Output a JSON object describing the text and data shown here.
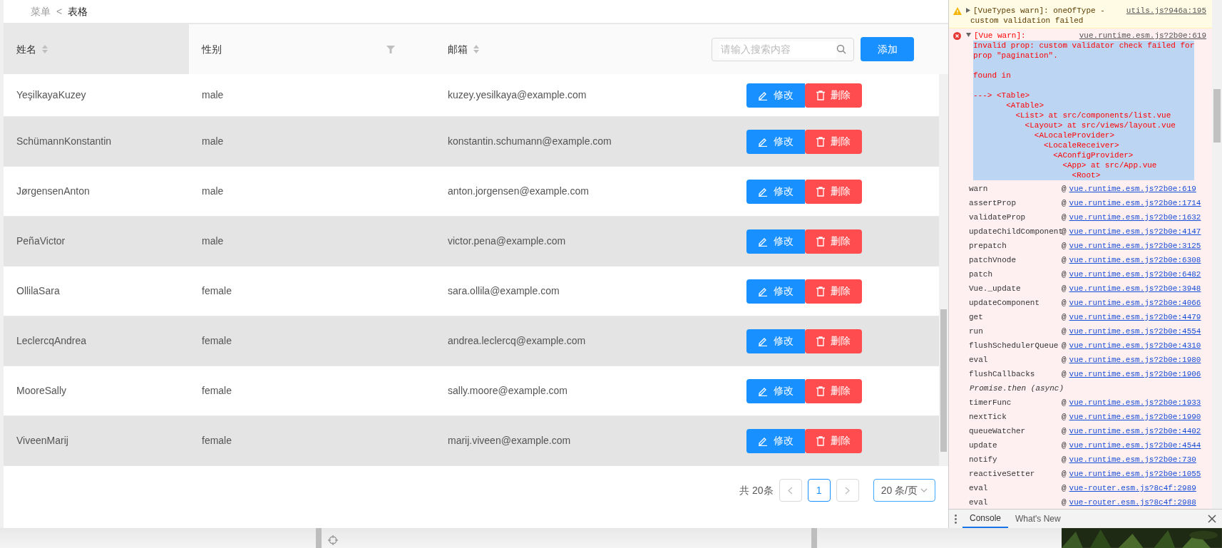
{
  "breadcrumb": {
    "items": [
      "菜单",
      "表格"
    ],
    "separator": "<"
  },
  "table": {
    "columns": [
      {
        "label": "姓名",
        "sortable": true,
        "filterable": false,
        "highlighted": true
      },
      {
        "label": "性别",
        "sortable": false,
        "filterable": true,
        "highlighted": false
      },
      {
        "label": "邮箱",
        "sortable": true,
        "filterable": false,
        "highlighted": false
      }
    ],
    "search": {
      "placeholder": "请输入搜索内容"
    },
    "add_button": "添加",
    "rows": [
      {
        "name": "YeşilkayaKuzey",
        "gender": "male",
        "email": "kuzey.yesilkaya@example.com",
        "actions": [
          "修改",
          "删除"
        ]
      },
      {
        "name": "SchümannKonstantin",
        "gender": "male",
        "email": "konstantin.schumann@example.com",
        "actions": [
          "修改",
          "删除"
        ]
      },
      {
        "name": "JørgensenAnton",
        "gender": "male",
        "email": "anton.jorgensen@example.com",
        "actions": [
          "修改",
          "删除"
        ]
      },
      {
        "name": "PeñaVictor",
        "gender": "male",
        "email": "victor.pena@example.com",
        "actions": [
          "修改",
          "删除"
        ]
      },
      {
        "name": "OllilaSara",
        "gender": "female",
        "email": "sara.ollila@example.com",
        "actions": [
          "修改",
          "删除"
        ]
      },
      {
        "name": "LeclercqAndrea",
        "gender": "female",
        "email": "andrea.leclercq@example.com",
        "actions": [
          "修改",
          "删除"
        ]
      },
      {
        "name": "MooreSally",
        "gender": "female",
        "email": "sally.moore@example.com",
        "actions": [
          "修改",
          "删除"
        ]
      },
      {
        "name": "ViveenMarij",
        "gender": "female",
        "email": "marij.viveen@example.com",
        "actions": [
          "修改",
          "删除"
        ]
      }
    ]
  },
  "pagination": {
    "total": "共 20条",
    "pages": [
      {
        "label": "1",
        "selected": true
      }
    ],
    "page_size": "20 条/页"
  },
  "console": {
    "messages": [
      {
        "kind": "warning",
        "expanded": false,
        "lines": [
          "[VueTypes warn]: oneOfType -",
          "custom validation failed"
        ],
        "source": "utils.js?946a:195"
      },
      {
        "kind": "error",
        "expanded": true,
        "lines": [
          "[Vue warn]:"
        ],
        "source": "vue.runtime.esm.js?2b0e:619",
        "body": "Invalid prop: custom validator check failed for\nprop \"pagination\".\n\nfound in\n\n---> <Table>\n       <ATable>\n         <List> at src/components/list.vue\n           <Layout> at src/views/layout.vue\n             <ALocaleProvider>\n               <LocaleReceiver>\n                 <AConfigProvider>\n                   <App> at src/App.vue\n                     <Root>",
        "body_selected": true,
        "stack": [
          {
            "kind": "frame",
            "function": "warn",
            "at": "@",
            "source": "vue.runtime.esm.js?2b0e:619"
          },
          {
            "kind": "frame",
            "function": "assertProp",
            "at": "@",
            "source": "vue.runtime.esm.js?2b0e:1714"
          },
          {
            "kind": "frame",
            "function": "validateProp",
            "at": "@",
            "source": "vue.runtime.esm.js?2b0e:1632"
          },
          {
            "kind": "frame",
            "function": "updateChildComponent",
            "at": "@",
            "source": "vue.runtime.esm.js?2b0e:4147"
          },
          {
            "kind": "frame",
            "function": "prepatch",
            "at": "@",
            "source": "vue.runtime.esm.js?2b0e:3125"
          },
          {
            "kind": "frame",
            "function": "patchVnode",
            "at": "@",
            "source": "vue.runtime.esm.js?2b0e:6308"
          },
          {
            "kind": "frame",
            "function": "patch",
            "at": "@",
            "source": "vue.runtime.esm.js?2b0e:6482"
          },
          {
            "kind": "frame",
            "function": "Vue._update",
            "at": "@",
            "source": "vue.runtime.esm.js?2b0e:3948"
          },
          {
            "kind": "frame",
            "function": "updateComponent",
            "at": "@",
            "source": "vue.runtime.esm.js?2b0e:4066"
          },
          {
            "kind": "frame",
            "function": "get",
            "at": "@",
            "source": "vue.runtime.esm.js?2b0e:4479"
          },
          {
            "kind": "frame",
            "function": "run",
            "at": "@",
            "source": "vue.runtime.esm.js?2b0e:4554"
          },
          {
            "kind": "frame",
            "function": "flushSchedulerQueue",
            "at": "@",
            "source": "vue.runtime.esm.js?2b0e:4310"
          },
          {
            "kind": "frame",
            "function": "eval",
            "at": "@",
            "source": "vue.runtime.esm.js?2b0e:1980"
          },
          {
            "kind": "frame",
            "function": "flushCallbacks",
            "at": "@",
            "source": "vue.runtime.esm.js?2b0e:1906"
          },
          {
            "kind": "async",
            "function": "Promise.then (async)"
          },
          {
            "kind": "frame",
            "function": "timerFunc",
            "at": "@",
            "source": "vue.runtime.esm.js?2b0e:1933"
          },
          {
            "kind": "frame",
            "function": "nextTick",
            "at": "@",
            "source": "vue.runtime.esm.js?2b0e:1990"
          },
          {
            "kind": "frame",
            "function": "queueWatcher",
            "at": "@",
            "source": "vue.runtime.esm.js?2b0e:4402"
          },
          {
            "kind": "frame",
            "function": "update",
            "at": "@",
            "source": "vue.runtime.esm.js?2b0e:4544"
          },
          {
            "kind": "frame",
            "function": "notify",
            "at": "@",
            "source": "vue.runtime.esm.js?2b0e:730"
          },
          {
            "kind": "frame",
            "function": "reactiveSetter",
            "at": "@",
            "source": "vue.runtime.esm.js?2b0e:1055"
          },
          {
            "kind": "frame",
            "function": "eval",
            "at": "@",
            "source": "vue-router.esm.js?8c4f:2989"
          },
          {
            "kind": "frame",
            "function": "eval",
            "at": "@",
            "source": "vue-router.esm.js?8c4f:2988"
          }
        ]
      }
    ],
    "drawer_tabs": [
      {
        "label": "Console",
        "selected": true
      },
      {
        "label": "What's New",
        "selected": false
      }
    ]
  }
}
